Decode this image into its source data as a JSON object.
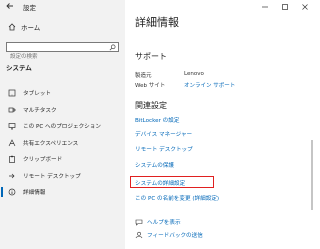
{
  "window": {
    "title": "設定"
  },
  "sidebar": {
    "home_label": "ホーム",
    "search_placeholder": "設定の検索",
    "section_title": "システム",
    "items": [
      {
        "label": "タブレット",
        "icon": "tablet-icon"
      },
      {
        "label": "マルチタスク",
        "icon": "multitask-icon"
      },
      {
        "label": "この PC へのプロジェクション",
        "icon": "projection-icon"
      },
      {
        "label": "共有エクスペリエンス",
        "icon": "shared-experiences-icon"
      },
      {
        "label": "クリップボード",
        "icon": "clipboard-icon"
      },
      {
        "label": "リモート デスクトップ",
        "icon": "remote-desktop-icon"
      },
      {
        "label": "詳細情報",
        "icon": "info-icon",
        "selected": true
      }
    ]
  },
  "main": {
    "title": "詳細情報",
    "support": {
      "heading": "サポート",
      "rows": [
        {
          "key": "製造元",
          "value": "Lenovo"
        },
        {
          "key": "Web サイト",
          "value": "オンライン サポート"
        }
      ]
    },
    "related": {
      "heading": "関連設定",
      "links": [
        "BitLocker の設定",
        "デバイス マネージャー",
        "リモート デスクトップ",
        "システムの保護",
        "システムの詳細設定",
        "この PC の名前を変更 (詳細設定)"
      ],
      "highlighted_index": 4
    },
    "help": [
      {
        "label": "ヘルプを表示",
        "icon": "help-icon"
      },
      {
        "label": "フィードバックの送信",
        "icon": "feedback-icon"
      }
    ]
  },
  "colors": {
    "accent": "#0067b8",
    "highlight": "#e02020",
    "sidebar_bg": "#f2f2f2"
  }
}
